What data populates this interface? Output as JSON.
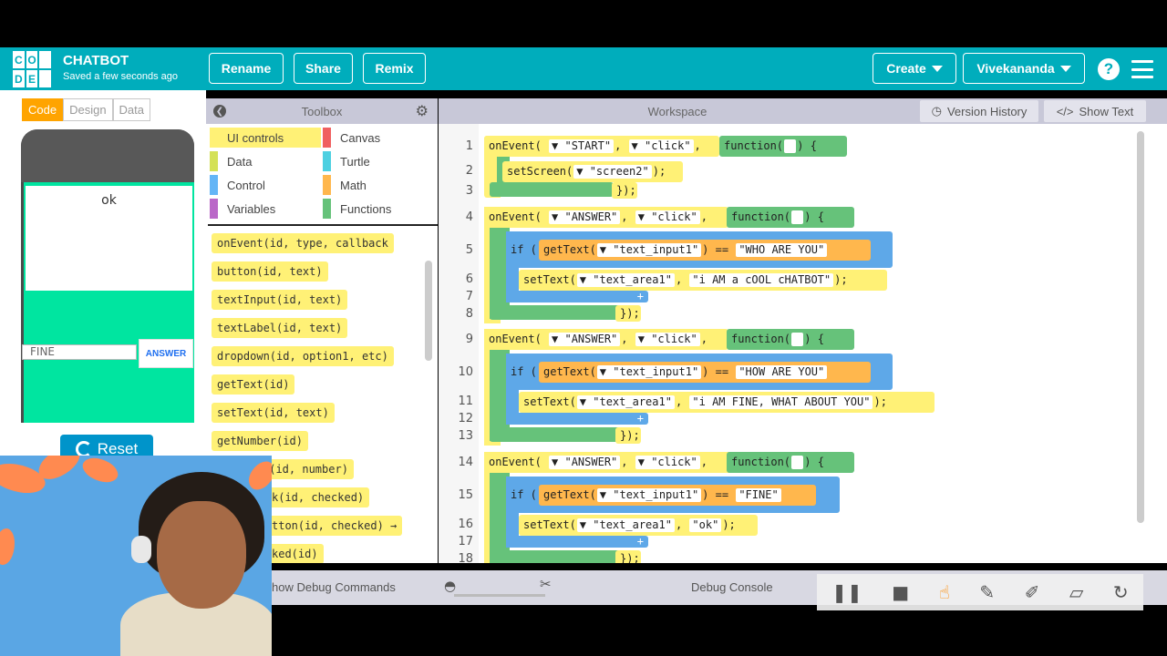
{
  "header": {
    "logo_letters": [
      "C",
      "O",
      "D",
      "D",
      "E",
      ""
    ],
    "app_title": "CHATBOT",
    "saved_status": "Saved a few seconds ago",
    "rename_label": "Rename",
    "share_label": "Share",
    "remix_label": "Remix",
    "create_label": "Create",
    "user_label": "Vivekananda",
    "help_glyph": "?"
  },
  "mode_tabs": [
    "Code",
    "Design",
    "Data"
  ],
  "app_preview": {
    "text_area_value": "ok",
    "text_input_value": "FINE",
    "answer_button": "ANSWER",
    "reset_label": "Reset"
  },
  "toolbox": {
    "title": "Toolbox",
    "categories": [
      {
        "label": "UI controls",
        "color": "#fff176"
      },
      {
        "label": "Canvas",
        "color": "#f06060"
      },
      {
        "label": "Data",
        "color": "#d4e157"
      },
      {
        "label": "Turtle",
        "color": "#4dd0e1"
      },
      {
        "label": "Control",
        "color": "#64b5f6"
      },
      {
        "label": "Math",
        "color": "#ffb74d"
      },
      {
        "label": "Variables",
        "color": "#ba68c8"
      },
      {
        "label": "Functions",
        "color": "#66c27a"
      }
    ],
    "blocks": [
      "onEvent(id, type, callback",
      "button(id, text)",
      "textInput(id, text)",
      "textLabel(id, text)",
      "dropdown(id, option1, etc)",
      "getText(id)",
      "setText(id, text)",
      "getNumber(id)",
      "r(id, number)",
      "k(id, checked)",
      "tton(id, checked) →",
      "ked(id)"
    ]
  },
  "workspace": {
    "title": "Workspace",
    "version_history_label": "Version History",
    "show_text_label": "Show Text",
    "line_numbers": [
      "1",
      "2",
      "3",
      "4",
      "5",
      "6",
      "7",
      "8",
      "9",
      "10",
      "11",
      "12",
      "13",
      "14",
      "15",
      "16",
      "17",
      "18"
    ],
    "code": {
      "ev1": {
        "kw": "onEvent(",
        "id": "\"START\"",
        "type": "\"click\"",
        "fn": "function(",
        "close": ") {"
      },
      "ev1_set": {
        "fn": "setScreen(",
        "arg": "\"screen2\"",
        "close": ");"
      },
      "ev1_end": "});",
      "ev2": {
        "kw": "onEvent(",
        "id": "\"ANSWER\"",
        "type": "\"click\"",
        "fn": "function(",
        "close": ") {"
      },
      "ev2_if": {
        "kw": "if (",
        "get": "getText(",
        "arg": "\"text_input1\"",
        "close": ")",
        "eq": "==",
        "val": "\"WHO ARE YOU\"",
        "brace": ") {"
      },
      "ev2_set": {
        "fn": "setText(",
        "arg1": "\"text_area1\"",
        "arg2": "\"i AM a cOOL cHATBOT\"",
        "close": ");"
      },
      "ev2_end": "});",
      "ev3": {
        "kw": "onEvent(",
        "id": "\"ANSWER\"",
        "type": "\"click\"",
        "fn": "function(",
        "close": ") {"
      },
      "ev3_if": {
        "kw": "if (",
        "get": "getText(",
        "arg": "\"text_input1\"",
        "close": ")",
        "eq": "==",
        "val": "\"HOW ARE YOU\"",
        "brace": ") {"
      },
      "ev3_set": {
        "fn": "setText(",
        "arg1": "\"text_area1\"",
        "arg2": "\"i AM FINE, WHAT ABOUT YOU\"",
        "close": ");"
      },
      "ev3_end": "});",
      "ev4": {
        "kw": "onEvent(",
        "id": "\"ANSWER\"",
        "type": "\"click\"",
        "fn": "function(",
        "close": ") {"
      },
      "ev4_if": {
        "kw": "if (",
        "get": "getText(",
        "arg": "\"text_input1\"",
        "close": ")",
        "eq": "==",
        "val": "\"FINE\"",
        "brace": ") {"
      },
      "ev4_set": {
        "fn": "setText(",
        "arg1": "\"text_area1\"",
        "arg2": "\"ok\"",
        "close": ");"
      },
      "ev4_end": "});",
      "plus": "+"
    }
  },
  "bottom_bar": {
    "debug_commands_label": "how Debug Commands",
    "debug_console_label": "Debug Console"
  },
  "icons": {
    "gear": "gear-icon",
    "back": "chevron-left-icon",
    "clock": "clock-icon",
    "code": "code-icon",
    "reset": "refresh-icon",
    "turtle": "turtle-icon",
    "rabbit": "rabbit-icon",
    "pause": "pause-icon",
    "stop": "stop-icon",
    "hand": "hand-pointer-icon",
    "pen": "pen-icon",
    "highlighter": "highlighter-icon",
    "eraser": "eraser-icon",
    "redo": "redo-icon"
  },
  "colors": {
    "header": "#00adbc",
    "event_block": "#fff176",
    "function_block": "#66c27a",
    "control_block": "#5ea8e8",
    "math_block": "#ffb74d",
    "app_screen": "#00e5a0"
  }
}
